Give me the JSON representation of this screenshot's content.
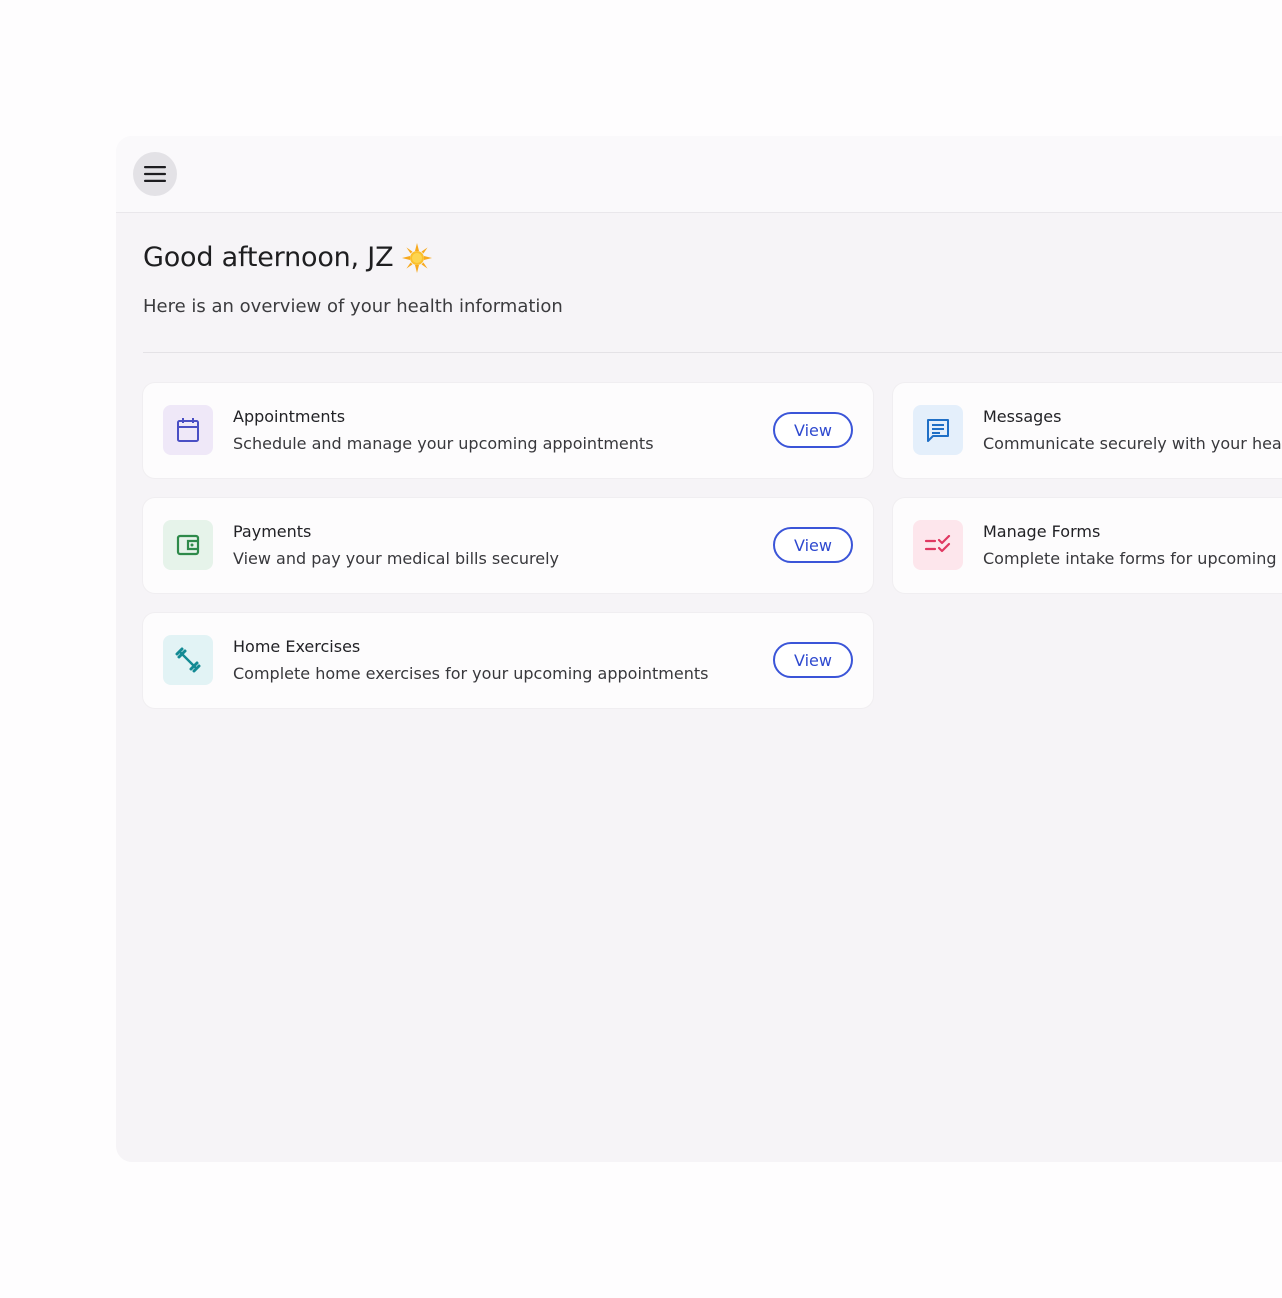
{
  "greeting": "Good afternoon, JZ",
  "subtitle": "Here is an overview of your health information",
  "cards": [
    {
      "title": "Appointments",
      "description": "Schedule and manage your upcoming appointments",
      "button": "View",
      "icon": "calendar-icon",
      "icon_bg": "#efe8f8",
      "icon_color": "#4a4fc4"
    },
    {
      "title": "Messages",
      "description": "Communicate securely with your health",
      "icon": "chat-icon",
      "icon_bg": "#e4effb",
      "icon_color": "#1f6fc6"
    },
    {
      "title": "Payments",
      "description": "View and pay your medical bills securely",
      "button": "View",
      "icon": "wallet-icon",
      "icon_bg": "#e6f3ea",
      "icon_color": "#2e8a4a"
    },
    {
      "title": "Manage Forms",
      "description": "Complete intake forms for upcoming ap",
      "icon": "checklist-icon",
      "icon_bg": "#fde6ec",
      "icon_color": "#e03862"
    },
    {
      "title": "Home Exercises",
      "description": "Complete home exercises for your upcoming appointments",
      "button": "View",
      "icon": "dumbbell-icon",
      "icon_bg": "#e2f3f5",
      "icon_color": "#138a94"
    }
  ],
  "colors": {
    "accent": "#3b55d8",
    "background": "#f6f4f7",
    "card": "#fdfcfd"
  }
}
